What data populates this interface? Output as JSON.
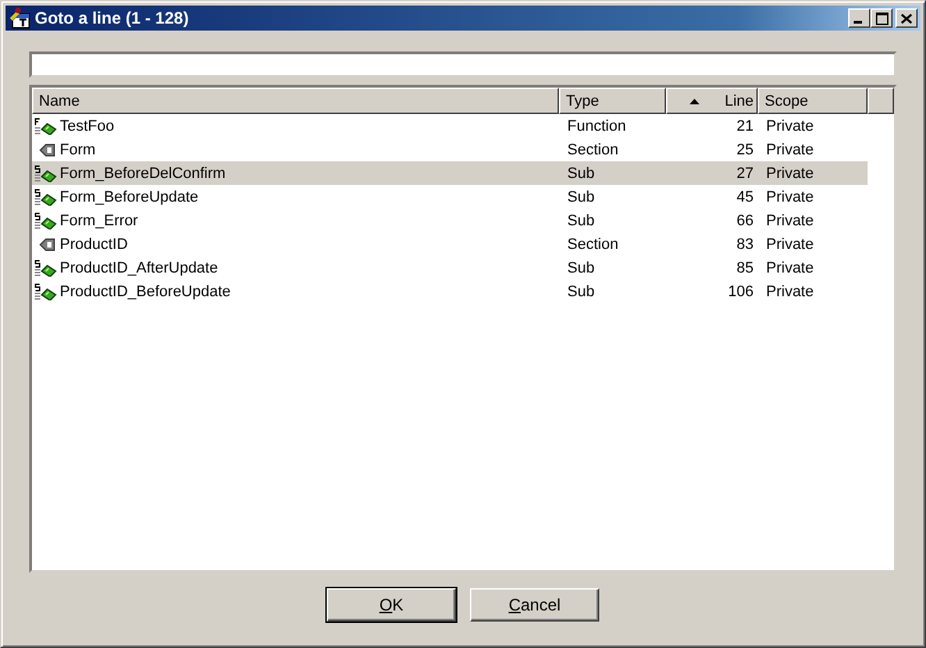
{
  "window": {
    "title": "Goto a line (1 - 128)"
  },
  "table": {
    "columns": [
      {
        "label": "Name",
        "sorted": false
      },
      {
        "label": "Type",
        "sorted": false
      },
      {
        "label": "Line",
        "sorted": true
      },
      {
        "label": "Scope",
        "sorted": false
      }
    ],
    "rows": [
      {
        "kind": "function",
        "name": "TestFoo",
        "type": "Function",
        "line": "21",
        "scope": "Private",
        "selected": false
      },
      {
        "kind": "section",
        "name": "Form",
        "type": "Section",
        "line": "25",
        "scope": "Private",
        "selected": false
      },
      {
        "kind": "sub",
        "name": "Form_BeforeDelConfirm",
        "type": "Sub",
        "line": "27",
        "scope": "Private",
        "selected": true
      },
      {
        "kind": "sub",
        "name": "Form_BeforeUpdate",
        "type": "Sub",
        "line": "45",
        "scope": "Private",
        "selected": false
      },
      {
        "kind": "sub",
        "name": "Form_Error",
        "type": "Sub",
        "line": "66",
        "scope": "Private",
        "selected": false
      },
      {
        "kind": "section",
        "name": "ProductID",
        "type": "Section",
        "line": "83",
        "scope": "Private",
        "selected": false
      },
      {
        "kind": "sub",
        "name": "ProductID_AfterUpdate",
        "type": "Sub",
        "line": "85",
        "scope": "Private",
        "selected": false
      },
      {
        "kind": "sub",
        "name": "ProductID_BeforeUpdate",
        "type": "Sub",
        "line": "106",
        "scope": "Private",
        "selected": false
      }
    ]
  },
  "buttons": [
    {
      "mnemonic": "O",
      "rest": "K",
      "default": true
    },
    {
      "mnemonic": "C",
      "rest": "ancel",
      "default": false
    }
  ]
}
